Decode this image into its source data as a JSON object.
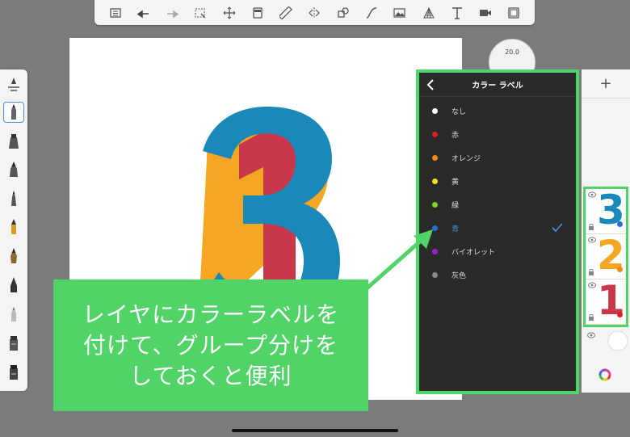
{
  "toolbar": {
    "buttons": [
      {
        "name": "list-icon"
      },
      {
        "name": "undo-icon"
      },
      {
        "name": "redo-icon"
      },
      {
        "name": "selection-icon"
      },
      {
        "name": "transform-icon"
      },
      {
        "name": "canvas-icon"
      },
      {
        "name": "ruler-icon"
      },
      {
        "name": "symmetry-icon"
      },
      {
        "name": "shape-icon"
      },
      {
        "name": "curve-icon"
      },
      {
        "name": "image-icon"
      },
      {
        "name": "perspective-icon"
      },
      {
        "name": "text-icon"
      },
      {
        "name": "video-icon"
      },
      {
        "name": "fullscreen-icon"
      }
    ]
  },
  "dial": {
    "value": "20.0"
  },
  "panel": {
    "title": "カラー ラベル",
    "items": [
      {
        "label": "なし",
        "color": "#ffffff",
        "selected": false
      },
      {
        "label": "赤",
        "color": "#e02020",
        "selected": false
      },
      {
        "label": "オレンジ",
        "color": "#f08a10",
        "selected": false
      },
      {
        "label": "黄",
        "color": "#f5e020",
        "selected": false
      },
      {
        "label": "緑",
        "color": "#7ed321",
        "selected": false
      },
      {
        "label": "青",
        "color": "#1f6fd6",
        "selected": true
      },
      {
        "label": "バイオレット",
        "color": "#a020d0",
        "selected": false
      },
      {
        "label": "灰色",
        "color": "#8a8a8a",
        "selected": false
      }
    ]
  },
  "right_panel": {
    "add_label": "+",
    "layers": [
      {
        "digit": "3",
        "digit_color": "#1a88b8",
        "dot_color": "#1f6fd6"
      },
      {
        "digit": "2",
        "digit_color": "#f5a623",
        "dot_color": "#f08a10"
      },
      {
        "digit": "1",
        "digit_color": "#c8374a",
        "dot_color": "#e02020"
      }
    ]
  },
  "callout": {
    "lines": [
      "レイヤにカラーラベルを",
      "付けて、グループ分けを",
      "しておくと便利"
    ]
  },
  "colors": {
    "highlight": "#4fd466",
    "blue_digit": "#1a88b8",
    "orange_digit": "#f5a623",
    "red_digit": "#c8374a"
  }
}
